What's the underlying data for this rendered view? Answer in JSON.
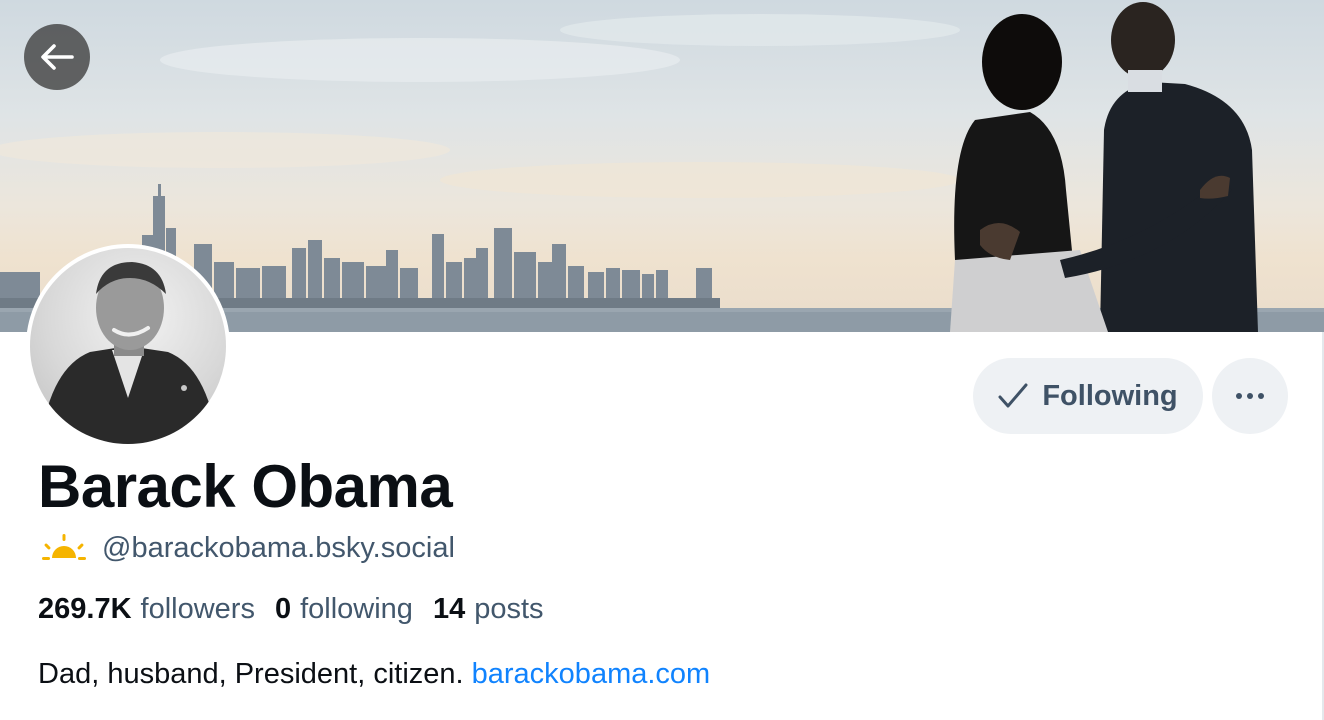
{
  "profile": {
    "display_name": "Barack Obama",
    "handle": "@barackobama.bsky.social",
    "bio_text": "Dad, husband, President, citizen. ",
    "bio_link": "barackobama.com"
  },
  "stats": {
    "followers_count": "269.7K",
    "followers_label": "followers",
    "following_count": "0",
    "following_label": "following",
    "posts_count": "14",
    "posts_label": "posts"
  },
  "actions": {
    "following_label": "Following"
  },
  "icons": {
    "back": "arrow-left-icon",
    "check": "check-icon",
    "more": "ellipsis-icon",
    "sunrise": "sunrise-icon"
  },
  "colors": {
    "link": "#1083fe",
    "muted_text": "#42576c",
    "button_bg": "#eef1f4",
    "sunrise": "#f5b400"
  }
}
